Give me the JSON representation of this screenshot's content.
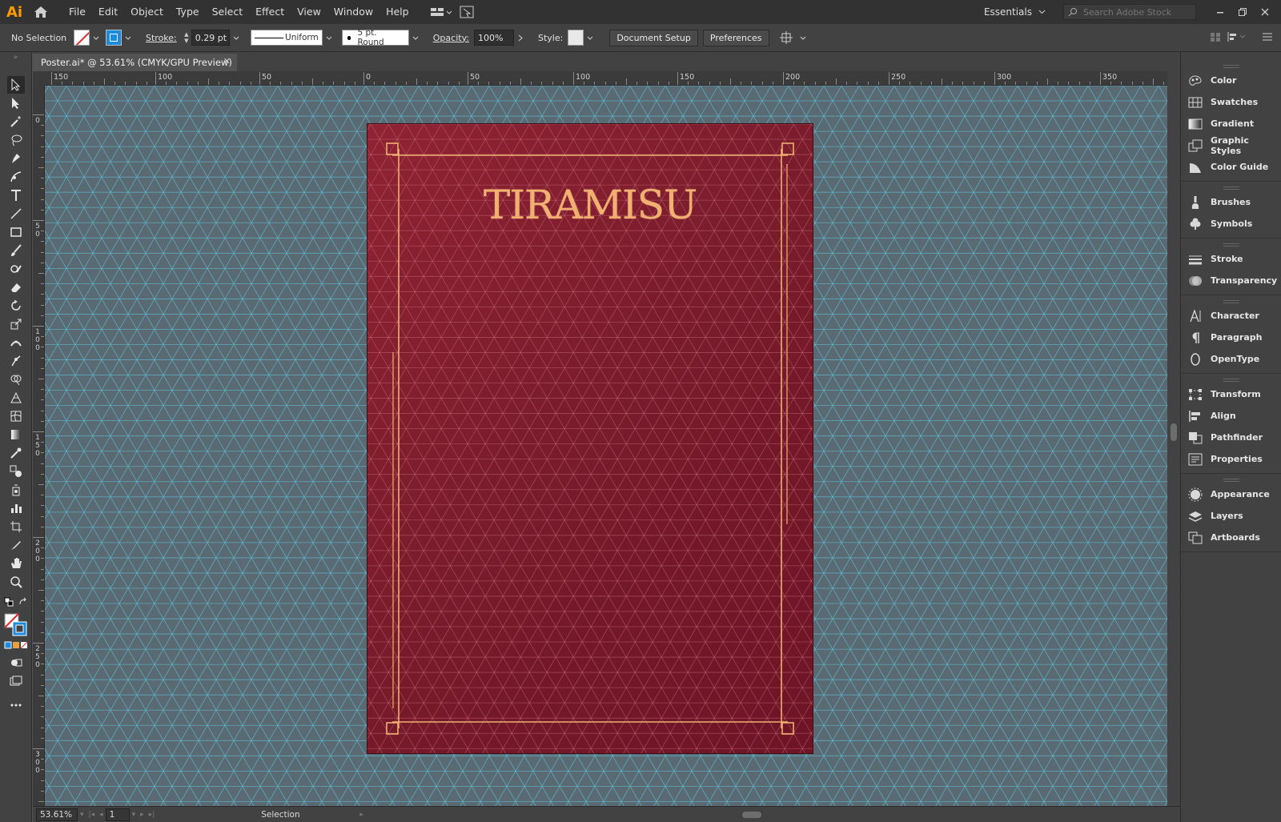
{
  "app": {
    "logo": "Ai",
    "menu": [
      "File",
      "Edit",
      "Object",
      "Type",
      "Select",
      "Effect",
      "View",
      "Window",
      "Help"
    ],
    "workspace": "Essentials",
    "stock_placeholder": "Search Adobe Stock"
  },
  "control_bar": {
    "selection": "No Selection",
    "stroke_label": "Stroke:",
    "stroke_weight": "0.29 pt",
    "profile": "Uniform",
    "brush": "5 pt. Round",
    "opacity_label": "Opacity:",
    "opacity": "100%",
    "style_label": "Style:",
    "document_setup": "Document Setup",
    "preferences": "Preferences"
  },
  "document": {
    "tab_title": "Poster.ai* @ 53.61% (CMYK/GPU Preview)",
    "close": "✕",
    "artboard_title": "TIRAMISU"
  },
  "rulers": {
    "top": [
      "150",
      "100",
      "50",
      "0",
      "50",
      "100",
      "150",
      "200",
      "250",
      "300",
      "350"
    ],
    "left": [
      "0",
      "50",
      "100",
      "150",
      "200",
      "250",
      "300"
    ]
  },
  "status": {
    "zoom": "53.61%",
    "artboard": "1",
    "tool": "Selection"
  },
  "panels": [
    {
      "group": [
        "Color",
        "Swatches",
        "Gradient",
        "Graphic Styles",
        "Color Guide"
      ]
    },
    {
      "group": [
        "Brushes",
        "Symbols"
      ]
    },
    {
      "group": [
        "Stroke",
        "Transparency"
      ]
    },
    {
      "group": [
        "Character",
        "Paragraph",
        "OpenType"
      ]
    },
    {
      "group": [
        "Transform",
        "Align",
        "Pathfinder",
        "Properties"
      ]
    },
    {
      "group": [
        "Appearance",
        "Layers",
        "Artboards"
      ]
    }
  ],
  "colors": {
    "grid": "#5fb3c9",
    "artboard": "#7d1c2d",
    "gold": "#f0b070"
  }
}
